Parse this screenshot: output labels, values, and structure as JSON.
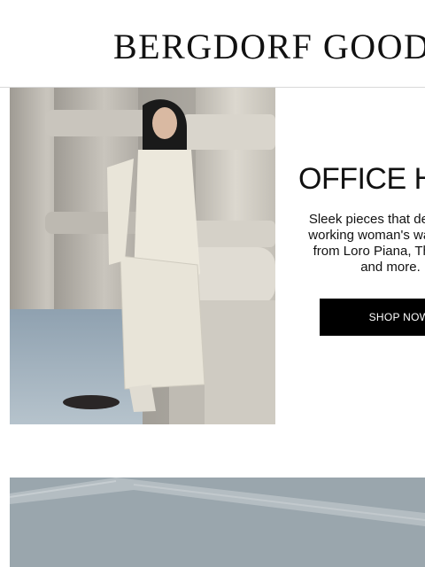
{
  "brand": {
    "logo_text": "BERGDORF GOODMAN"
  },
  "promo": {
    "headline": "OFFICE HOURS",
    "body": "Sleek pieces that define the working woman's wardrobe, from Loro Piana, The Row and more.",
    "cta_label": "SHOP NOW"
  },
  "colors": {
    "background": "#ffffff",
    "text": "#111111",
    "button": "#000000",
    "button_text": "#ffffff"
  }
}
